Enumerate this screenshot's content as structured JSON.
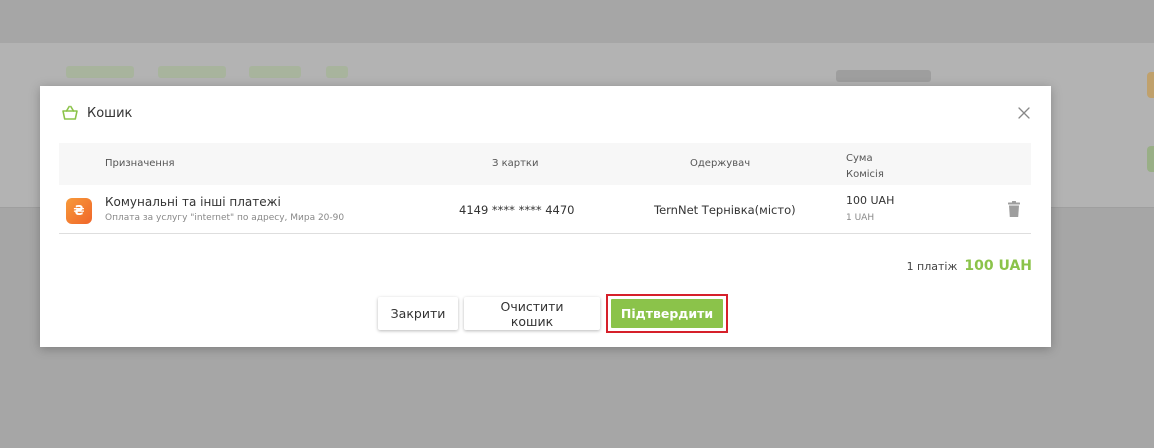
{
  "modal": {
    "title": "Кошик",
    "icons": {
      "basket": "basket-icon",
      "close": "close-icon"
    }
  },
  "table": {
    "headers": {
      "purpose": "Призначення",
      "card": "З картки",
      "recipient": "Одержувач",
      "amount": "Сума",
      "fee": "Комісія"
    },
    "rows": [
      {
        "icon": "utility-payment-icon",
        "icon_glyph": "₴",
        "service": "Комунальні та інші платежі",
        "description": "Оплата за услугу \"internet\" по адресу, Мира 20-90",
        "card": "4149 **** **** 4470",
        "recipient": "TernNet Тернівка(місто)",
        "amount": "100 UAH",
        "fee": "1 UAH"
      }
    ]
  },
  "total": {
    "count": "1 платіж",
    "sum": "100 UAH"
  },
  "buttons": {
    "close": "Закрити",
    "clear": "Очистити кошик",
    "confirm": "Підтвердити"
  },
  "colors": {
    "accent": "#8bc34a",
    "highlight": "#d6202a",
    "service_icon": "#f57c30"
  }
}
